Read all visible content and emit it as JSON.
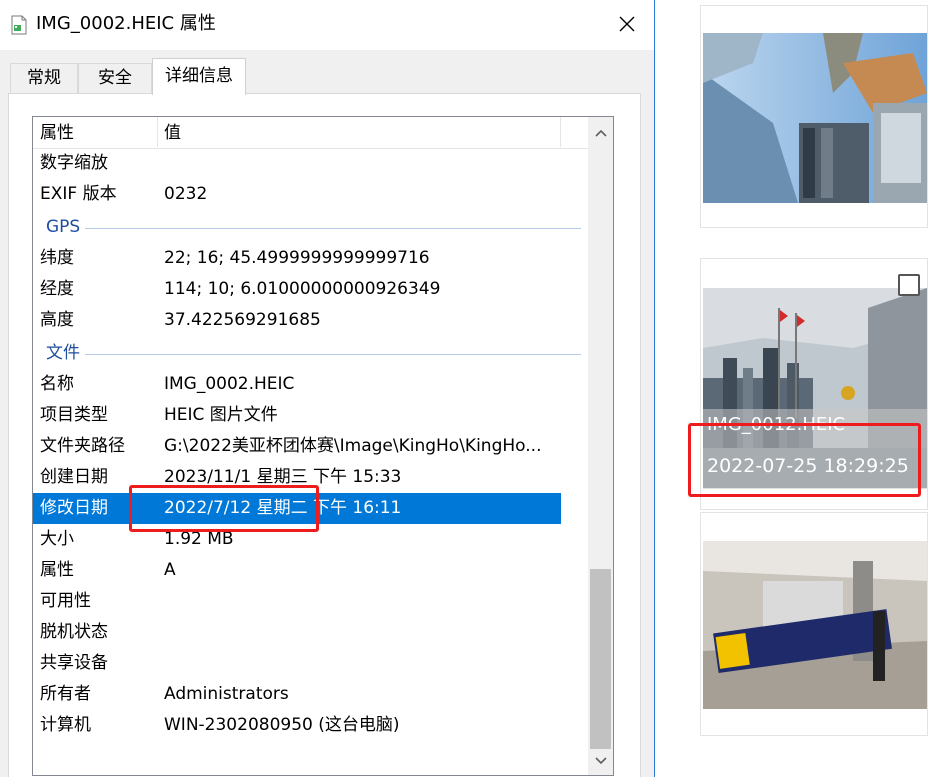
{
  "dialog": {
    "title": "IMG_0002.HEIC 属性",
    "tabs": [
      "常规",
      "安全",
      "详细信息"
    ],
    "active_tab": "详细信息"
  },
  "list": {
    "header": {
      "property": "属性",
      "value": "值"
    },
    "rows_top": [
      {
        "k": "数字缩放",
        "v": ""
      },
      {
        "k": "EXIF 版本",
        "v": "0232"
      }
    ],
    "group_gps": "GPS",
    "rows_gps": [
      {
        "k": "纬度",
        "v": "22; 16; 45.4999999999999716"
      },
      {
        "k": "经度",
        "v": "114; 10; 6.01000000000926349"
      },
      {
        "k": "高度",
        "v": "37.422569291685"
      }
    ],
    "group_file": "文件",
    "rows_file": [
      {
        "k": "名称",
        "v": "IMG_0002.HEIC"
      },
      {
        "k": "项目类型",
        "v": "HEIC 图片文件"
      },
      {
        "k": "文件夹路径",
        "v": "G:\\2022美亚杯团体赛\\Image\\KingHo\\KingHo..."
      },
      {
        "k": "创建日期",
        "v": "2023/11/1 星期三 下午 15:33"
      },
      {
        "k": "修改日期",
        "v": "2022/7/12 星期二 下午 16:11"
      },
      {
        "k": "大小",
        "v": "1.92 MB"
      },
      {
        "k": "属性",
        "v": "A"
      },
      {
        "k": "可用性",
        "v": ""
      },
      {
        "k": "脱机状态",
        "v": ""
      },
      {
        "k": "共享设备",
        "v": ""
      },
      {
        "k": "所有者",
        "v": "Administrators"
      },
      {
        "k": "计算机",
        "v": "WIN-2302080950 (这台电脑)"
      }
    ],
    "selected_row": "修改日期"
  },
  "thumbnails": {
    "overlay_name": "IMG_0012.HEIC",
    "overlay_date": "2022-07-25 18:29:25"
  },
  "colors": {
    "accent": "#0078d7",
    "annotation": "#ee1c1c",
    "group_text": "#1e4e9e"
  },
  "icons": [
    "file-icon",
    "close-icon",
    "chevron-up-icon",
    "chevron-down-icon",
    "checkbox-icon"
  ]
}
